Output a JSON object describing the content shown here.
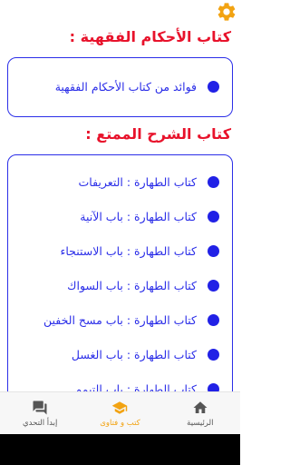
{
  "header": {
    "settings_icon": "gear-icon",
    "accent_color": "#f2a312"
  },
  "section1": {
    "title": "كتاب الأحكام الفقهية :",
    "items": [
      {
        "label": "فوائد من كتاب الأحكام الفقهية"
      }
    ]
  },
  "section2": {
    "title": "كتاب  الشرح الممتع :",
    "items": [
      {
        "label": "كتاب الطهارة : التعريفات"
      },
      {
        "label": "كتاب الطهارة : باب الآنية"
      },
      {
        "label": "كتاب الطهارة : باب الاستنجاء"
      },
      {
        "label": "كتاب الطهارة : باب السواك"
      },
      {
        "label": "كتاب الطهارة : باب مسح الخفين"
      },
      {
        "label": "كتاب الطهارة : باب الغسل"
      },
      {
        "label": "كتاب الطهارة : باب التيمم"
      }
    ]
  },
  "bottom_nav": {
    "items": [
      {
        "label": "إبدأ التحدي",
        "icon": "chat-icon",
        "active": false
      },
      {
        "label": "كتب و فتاوى",
        "icon": "graduation-cap-icon",
        "active": true
      },
      {
        "label": "الرئيسية",
        "icon": "home-icon",
        "active": false
      }
    ]
  },
  "colors": {
    "title": "#e8122b",
    "item": "#2b2ee8",
    "dot": "#2121e6",
    "active": "#f2a312",
    "inactive": "#555555"
  }
}
